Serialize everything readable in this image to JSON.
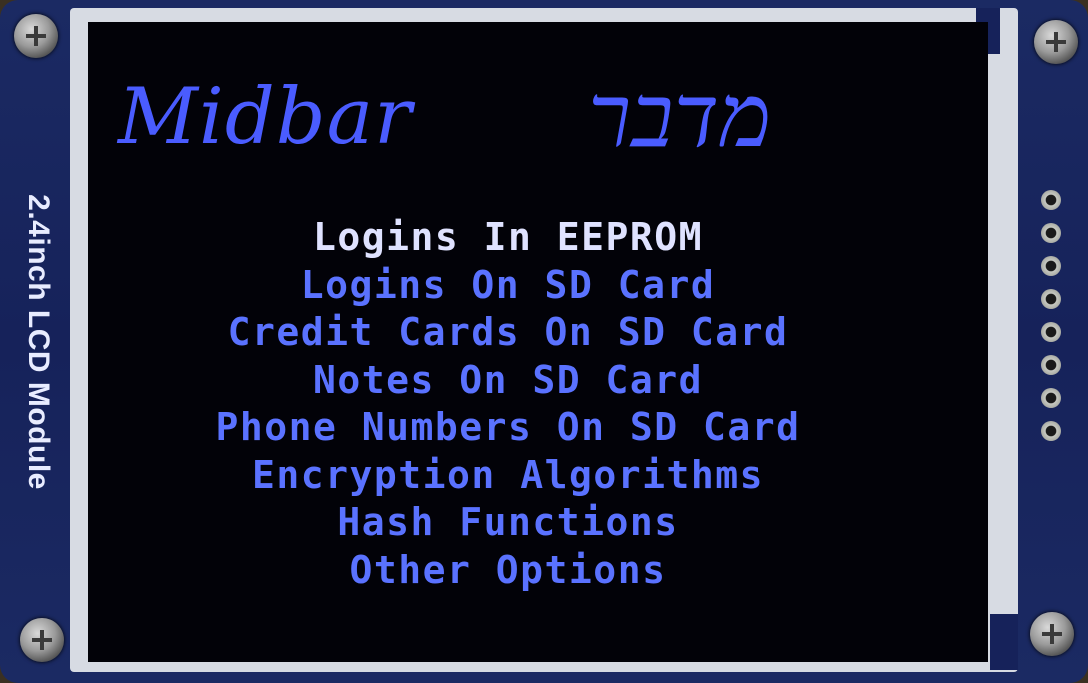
{
  "board": {
    "module_label": "2.4inch LCD Module",
    "pcb_color": "#16225a"
  },
  "display": {
    "background": "#020208",
    "accent_color": "#5a72ff",
    "selected_color": "#dfe2ff",
    "title_latin": "Midbar",
    "title_hebrew": "מדבר",
    "menu": {
      "selected_index": 0,
      "items": [
        {
          "label": "Logins In EEPROM"
        },
        {
          "label": "Logins On SD Card"
        },
        {
          "label": "Credit Cards On SD Card"
        },
        {
          "label": "Notes On SD Card"
        },
        {
          "label": "Phone Numbers On SD Card"
        },
        {
          "label": "Encryption Algorithms"
        },
        {
          "label": "Hash Functions"
        },
        {
          "label": "Other Options"
        }
      ]
    }
  }
}
